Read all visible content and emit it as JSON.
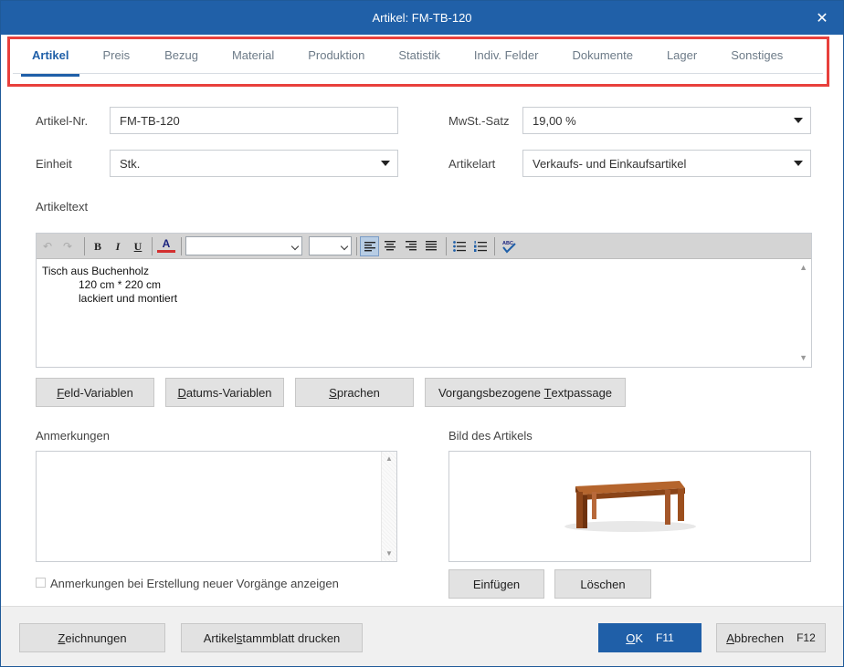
{
  "window": {
    "title": "Artikel: FM-TB-120",
    "close_glyph": "✕"
  },
  "tabs": [
    {
      "label": "Artikel",
      "active": true
    },
    {
      "label": "Preis",
      "active": false
    },
    {
      "label": "Bezug",
      "active": false
    },
    {
      "label": "Material",
      "active": false
    },
    {
      "label": "Produktion",
      "active": false
    },
    {
      "label": "Statistik",
      "active": false
    },
    {
      "label": "Indiv. Felder",
      "active": false
    },
    {
      "label": "Dokumente",
      "active": false
    },
    {
      "label": "Lager",
      "active": false
    },
    {
      "label": "Sonstiges",
      "active": false
    }
  ],
  "fields": {
    "artikel_nr_label": "Artikel-Nr.",
    "artikel_nr_value": "FM-TB-120",
    "einheit_label": "Einheit",
    "einheit_value": "Stk.",
    "mwst_label": "MwSt.-Satz",
    "mwst_value": "19,00 %",
    "artikelart_label": "Artikelart",
    "artikelart_value": "Verkaufs- und Einkaufsartikel",
    "artikeltext_label": "Artikeltext"
  },
  "editor": {
    "lines": [
      "Tisch aus Buchenholz",
      "            120 cm * 220 cm",
      "            lackiert und montiert"
    ],
    "toolbar": {
      "undo": "↶",
      "redo": "↷",
      "bold": "B",
      "italic": "I",
      "underline": "U",
      "font_color": "A",
      "spellcheck": "ABC"
    }
  },
  "text_buttons": {
    "feld": {
      "pre": "",
      "key": "F",
      "post": "eld-Variablen"
    },
    "datum": {
      "pre": "",
      "key": "D",
      "post": "atums-Variablen"
    },
    "sprachen": {
      "pre": "",
      "key": "S",
      "post": "prachen"
    },
    "vorgang": {
      "pre": "Vorgangsbezogene ",
      "key": "T",
      "post": "extpassage"
    }
  },
  "anmerkungen": {
    "label": "Anmerkungen",
    "checkbox_label": "Anmerkungen bei Erstellung neuer Vorgänge anzeigen"
  },
  "bild": {
    "label": "Bild des Artikels",
    "insert_label": "Einfügen",
    "delete_label": "Löschen"
  },
  "footer": {
    "zeichnungen": {
      "pre": "",
      "key": "Z",
      "post": "eichnungen"
    },
    "stammblatt": {
      "pre": "Artikel",
      "key": "s",
      "post": "tammblatt drucken"
    },
    "ok": {
      "key": "O",
      "post": "K",
      "fkey": "F11"
    },
    "abbrechen": {
      "key": "A",
      "post": "bbrechen",
      "fkey": "F12"
    }
  },
  "colors": {
    "titlebar": "#2060a8",
    "accent": "#1f5fa8",
    "highlight_border": "#e8403c"
  }
}
